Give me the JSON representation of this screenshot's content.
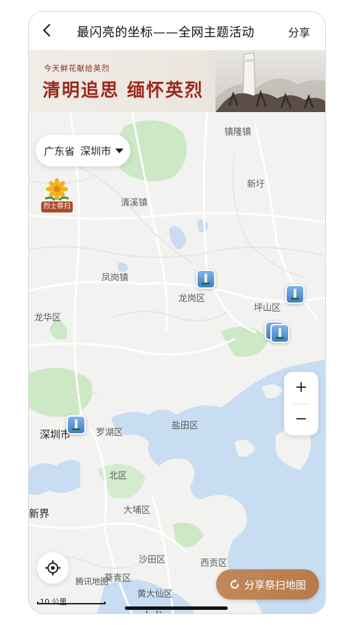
{
  "header": {
    "title": "最闪亮的坐标——全网主题活动",
    "share_label": "分享"
  },
  "banner": {
    "subtitle": "今天鲜花献给英烈",
    "title": "清明追思  缅怀英烈"
  },
  "location": {
    "province": "广东省",
    "city": "深圳市"
  },
  "martyr_badge": {
    "label": "烈士祭扫"
  },
  "map_labels": {
    "guanlan": "镇隆镇",
    "xinxu": "新圩",
    "qingxi": "清溪镇",
    "fenggang": "凤岗镇",
    "longgang": "龙岗区",
    "pingshan": "坪山区",
    "longhua": "龙华区",
    "shenzhen": "深圳市",
    "luohu": "罗湖区",
    "yantian": "盐田区",
    "north": "北区",
    "xinjie": "新界",
    "dapu": "大埔区",
    "shatian": "沙田区",
    "xigong": "西贡区",
    "kuiqing": "葵青区",
    "huangdaxian": "黄大仙区",
    "jiulong": "九龙"
  },
  "zoom": {
    "in_label": "+",
    "out_label": "−"
  },
  "share_map_label": "分享祭扫地图",
  "watermark": "腾讯地图",
  "scale_label": "10 公里",
  "icons": {
    "back": "chevron-left-icon",
    "locate": "crosshair-icon",
    "share_map": "refresh-arrow-icon",
    "memorial": "memorial-monument-icon",
    "flower": "chrysanthemum-icon"
  },
  "colors": {
    "sea": "#c8dcf2",
    "green": "#cde8c4",
    "land": "#f2f2f0",
    "banner_red": "#9a2a1a",
    "share_button": "#b87a4a"
  }
}
